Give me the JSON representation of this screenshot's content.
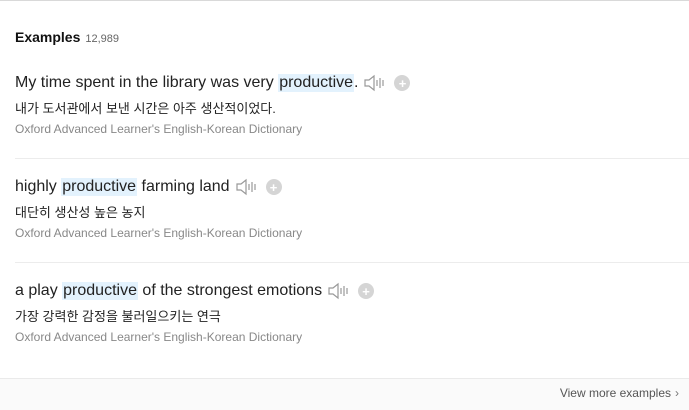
{
  "header": {
    "title": "Examples",
    "count": "12,989"
  },
  "examples": [
    {
      "before": "My time spent in the library was very ",
      "highlight": "productive",
      "after": ".",
      "translation": "내가 도서관에서 보낸 시간은 아주 생산적이었다.",
      "source": "Oxford Advanced Learner's English-Korean Dictionary"
    },
    {
      "before": "highly ",
      "highlight": "productive",
      "after": " farming land",
      "translation": "대단히 생산성 높은 농지",
      "source": "Oxford Advanced Learner's English-Korean Dictionary"
    },
    {
      "before": "a play ",
      "highlight": "productive",
      "after": " of the strongest emotions",
      "translation": "가장 강력한 감정을 불러일으키는 연극",
      "source": "Oxford Advanced Learner's English-Korean Dictionary"
    }
  ],
  "footer": {
    "view_more": "View more examples"
  },
  "colors": {
    "highlight": "#e3f2fd",
    "source_text": "#888888",
    "plus_button": "#d5d5d5"
  },
  "icons": {
    "speaker": "speaker-icon",
    "add": "plus-icon",
    "chevron": "chevron-right-icon"
  }
}
